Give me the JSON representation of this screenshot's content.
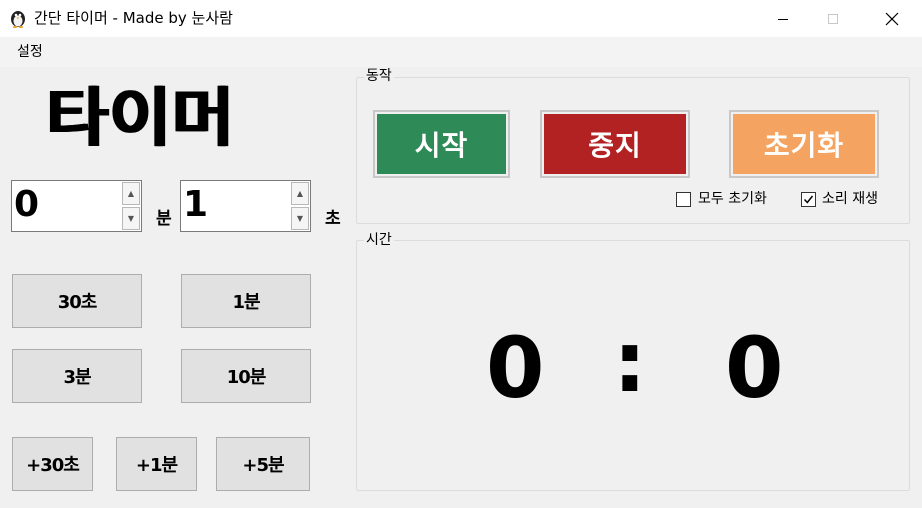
{
  "window": {
    "title": "간단 타이머 - Made by 눈사람",
    "app_icon": "penguin-icon"
  },
  "menu": {
    "settings": "설정"
  },
  "heading": "타이머",
  "inputs": {
    "minutes_value": "0",
    "minutes_unit": "분",
    "seconds_value": "1",
    "seconds_unit": "초"
  },
  "presets": {
    "s30": "30초",
    "m1": "1분",
    "m3": "3분",
    "m10": "10분",
    "add30s": "+30초",
    "add1m": "+1분",
    "add5m": "+5분"
  },
  "actions_group": {
    "label": "동작",
    "start": "시작",
    "stop": "중지",
    "reset": "초기화",
    "reset_all_label": "모두 초기화",
    "reset_all_checked": false,
    "sound_label": "소리 재생",
    "sound_checked": true
  },
  "time_group": {
    "label": "시간",
    "minutes": "0",
    "separator": ":",
    "seconds": "0"
  },
  "colors": {
    "start": "#2e8b57",
    "stop": "#b22222",
    "reset": "#f4a460"
  }
}
